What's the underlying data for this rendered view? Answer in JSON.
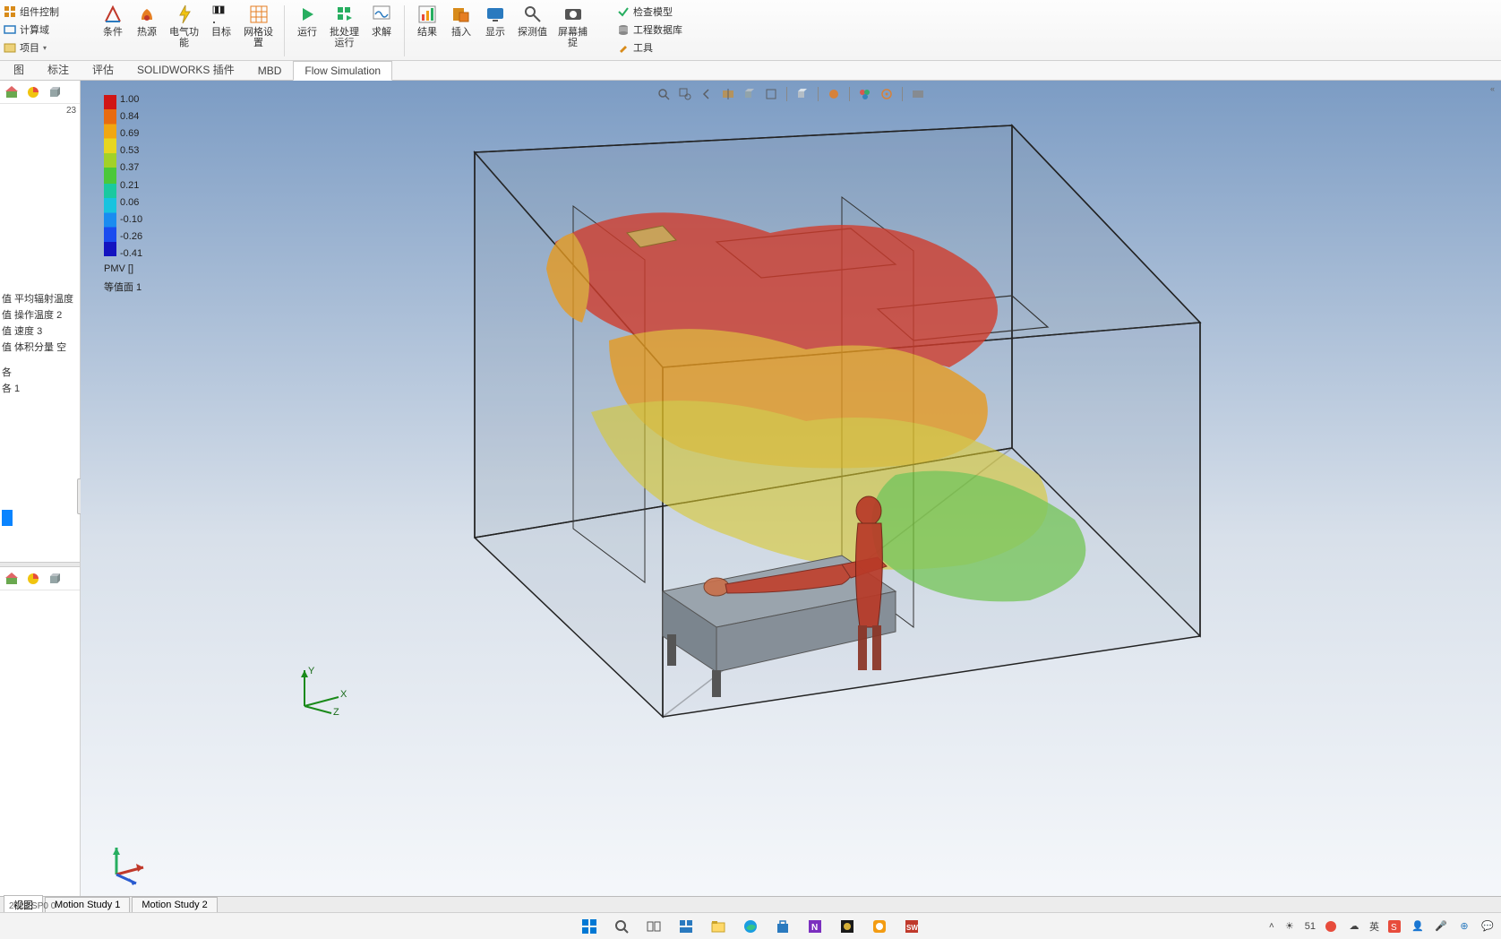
{
  "ribbon_left": {
    "component_control": "组件控制",
    "compute_domain": "计算域",
    "project": "项目"
  },
  "ribbon_buttons": {
    "conditions": "条件",
    "heat_source": "热源",
    "electrical": "电气功\n能",
    "goals": "目标",
    "mesh_settings": "网格设\n置",
    "run": "运行",
    "batch_run": "批处理\n运行",
    "solve": "求解",
    "results": "结果",
    "insert": "插入",
    "display": "显示",
    "probe": "探测值",
    "screen_capture": "屏幕捕\n捉"
  },
  "ribbon_right": {
    "check_model": "检查模型",
    "eng_db": "工程数据库",
    "tools": "工具"
  },
  "tabs": [
    "图",
    "标注",
    "评估",
    "SOLIDWORKS 插件",
    "MBD",
    "Flow Simulation"
  ],
  "active_tab_index": 5,
  "sidebar": {
    "corner_number": "23",
    "tree": [
      "值 平均辐射温度",
      "值 操作温度 2",
      "值 速度 3",
      "值 体积分量 空",
      "各",
      "各 1"
    ]
  },
  "legend": {
    "ticks": [
      "1.00",
      "0.84",
      "0.69",
      "0.53",
      "0.37",
      "0.21",
      "0.06",
      "-0.10",
      "-0.26",
      "-0.41"
    ],
    "unit": "PMV []",
    "name": "等值面 1"
  },
  "triad": {
    "x": "X",
    "y": "Y",
    "z": "Z"
  },
  "bottom_tabs": [
    "视图",
    "Motion Study 1",
    "Motion Study 2"
  ],
  "active_bottom_tab_index": 0,
  "status_text": "2022 SP0 0",
  "taskbar": {
    "tray_temp": "51",
    "ime_lang": "英"
  },
  "chart_data": {
    "type": "bar",
    "title": "PMV [] 等值面 1",
    "ylabel": "PMV",
    "categories": [
      "1.00",
      "0.84",
      "0.69",
      "0.53",
      "0.37",
      "0.21",
      "0.06",
      "-0.10",
      "-0.26",
      "-0.41"
    ],
    "values": [
      1.0,
      0.84,
      0.69,
      0.53,
      0.37,
      0.21,
      0.06,
      -0.1,
      -0.26,
      -0.41
    ],
    "colors": [
      "#d01515",
      "#e86b10",
      "#f0a712",
      "#e7d620",
      "#a2d128",
      "#4bc83a",
      "#1ac9a0",
      "#18c3df",
      "#1a8cf0",
      "#1313c0"
    ],
    "ylim": [
      -0.41,
      1.0
    ]
  }
}
